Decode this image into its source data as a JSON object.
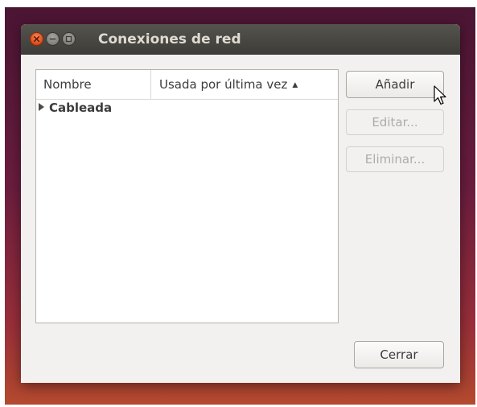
{
  "window": {
    "title": "Conexiones de red"
  },
  "list": {
    "columns": [
      {
        "label": "Nombre"
      },
      {
        "label": "Usada por última vez",
        "sort_indicator": "▲"
      }
    ],
    "rows": [
      {
        "label": "Cableada",
        "expander": "collapsed"
      }
    ]
  },
  "buttons": {
    "add_label": "Añadir",
    "edit_label": "Editar...",
    "delete_label": "Eliminar...",
    "close_label": "Cerrar"
  },
  "colors": {
    "titlebar": "#3d3c38",
    "window_bg": "#f2f1f0",
    "close_button": "#df4a16",
    "disabled_text": "#aeaca6",
    "desktop_top": "#4a1533",
    "desktop_bottom": "#b44a2e"
  },
  "icons": {
    "close": "close-icon",
    "minimize": "minimize-icon",
    "maximize": "maximize-icon",
    "expander": "triangle-right-icon",
    "sort": "sort-up-icon",
    "cursor": "mouse-pointer-icon"
  }
}
